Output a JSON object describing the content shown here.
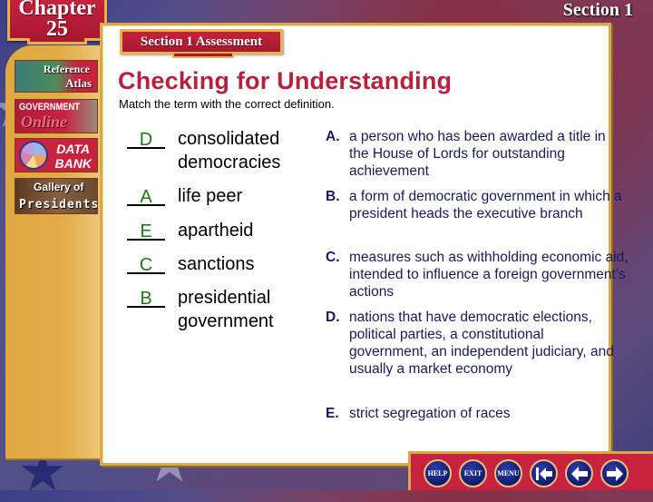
{
  "header": {
    "chapter_word": "Chapter",
    "chapter_number": "25",
    "section": "Section 1"
  },
  "sidebar": {
    "items": [
      {
        "line1": "Reference",
        "line2": "Atlas",
        "icon": "atlas-map-icon"
      },
      {
        "line1": "GOVERNMENT",
        "line2": "Online",
        "icon": "book-icon"
      },
      {
        "line1": "DATA",
        "line2": "BANK",
        "icon": "pie-chart-icon"
      },
      {
        "line1": "Gallery of",
        "line2": "Presidents",
        "icon": "presidents-portrait-icon"
      }
    ]
  },
  "main": {
    "section_tab": "Section 1 Assessment",
    "title": "Checking for Understanding",
    "instruction": "Match the term with the correct definition.",
    "terms": [
      {
        "answer": "D",
        "label": "consolidated democracies"
      },
      {
        "answer": "A",
        "label": "life peer"
      },
      {
        "answer": "E",
        "label": "apartheid"
      },
      {
        "answer": "C",
        "label": "sanctions"
      },
      {
        "answer": "B",
        "label": "presidential government"
      }
    ],
    "definitions": [
      {
        "letter": "A.",
        "text": "a person who has been awarded a title in the House of Lords for outstanding achievement"
      },
      {
        "letter": "B.",
        "text": "a form of democratic government in which a president heads the executive branch"
      },
      {
        "letter": "C.",
        "text": "measures such as withholding economic aid, intended to influence a foreign government’s actions"
      },
      {
        "letter": "D.",
        "text": "nations that have democratic elections, political parties, a constitutional government, an independent judiciary, and usually a market economy"
      },
      {
        "letter": "E.",
        "text": "strict segregation of races"
      }
    ]
  },
  "nav": {
    "help": "HELP",
    "exit": "EXIT",
    "menu": "MENU",
    "first_icon": "first-slide-icon",
    "prev_icon": "previous-arrow-icon",
    "next_icon": "next-arrow-icon"
  },
  "colors": {
    "accent_red": "#c7233f",
    "title_red": "#b8213d",
    "gold": "#e0a840",
    "answer_green": "#1a7a1a",
    "definition_navy": "#1a1a5a",
    "nav_blue": "#0e1a6e"
  }
}
